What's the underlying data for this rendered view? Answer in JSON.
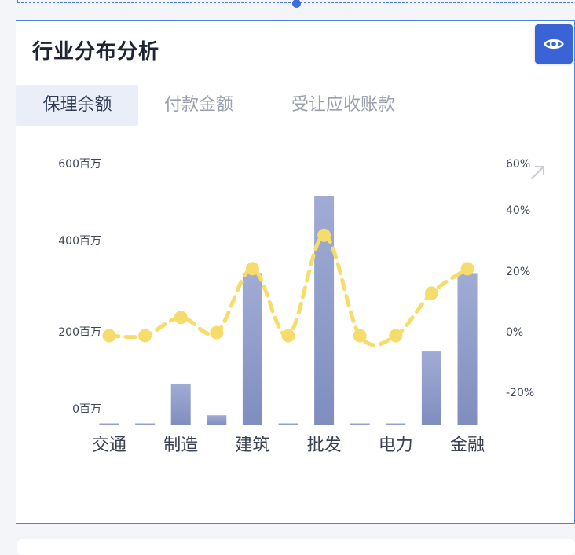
{
  "card": {
    "title": "行业分布分析"
  },
  "tabs": [
    {
      "label": "保理余额",
      "active": true
    },
    {
      "label": "付款金额",
      "active": false
    },
    {
      "label": "受让应收账款",
      "active": false
    }
  ],
  "icons": {
    "eye": "eye-icon",
    "expand": "arrow-up-right-icon"
  },
  "colors": {
    "bar": "#8f9dcc",
    "line": "#f6dc6b",
    "button": "#3a63d6",
    "border": "#4a84e0"
  },
  "chart_data": {
    "type": "bar",
    "categories": [
      "交通",
      "",
      "制造",
      "",
      "建筑",
      "",
      "批发",
      "",
      "电力",
      "",
      "金融"
    ],
    "x_tick_labels": [
      "交通",
      "制造",
      "建筑",
      "批发",
      "电力",
      "金融"
    ],
    "series": [
      {
        "axis": "left",
        "type": "bar",
        "values": [
          4,
          4,
          83,
          20,
          303,
          4,
          457,
          4,
          4,
          147,
          303
        ]
      },
      {
        "axis": "right",
        "type": "line",
        "style": "dashed",
        "values": [
          0,
          0,
          6,
          1,
          22,
          0,
          33,
          0,
          0,
          14,
          22
        ]
      }
    ],
    "y_left": {
      "ticks": [
        "600百万",
        "400百万",
        "200百万",
        "0百万"
      ],
      "ylim": [
        0,
        600
      ]
    },
    "y_right": {
      "ticks": [
        "60%",
        "40%",
        "20%",
        "0%",
        "-20%"
      ],
      "ylim": [
        -20,
        60
      ]
    }
  }
}
